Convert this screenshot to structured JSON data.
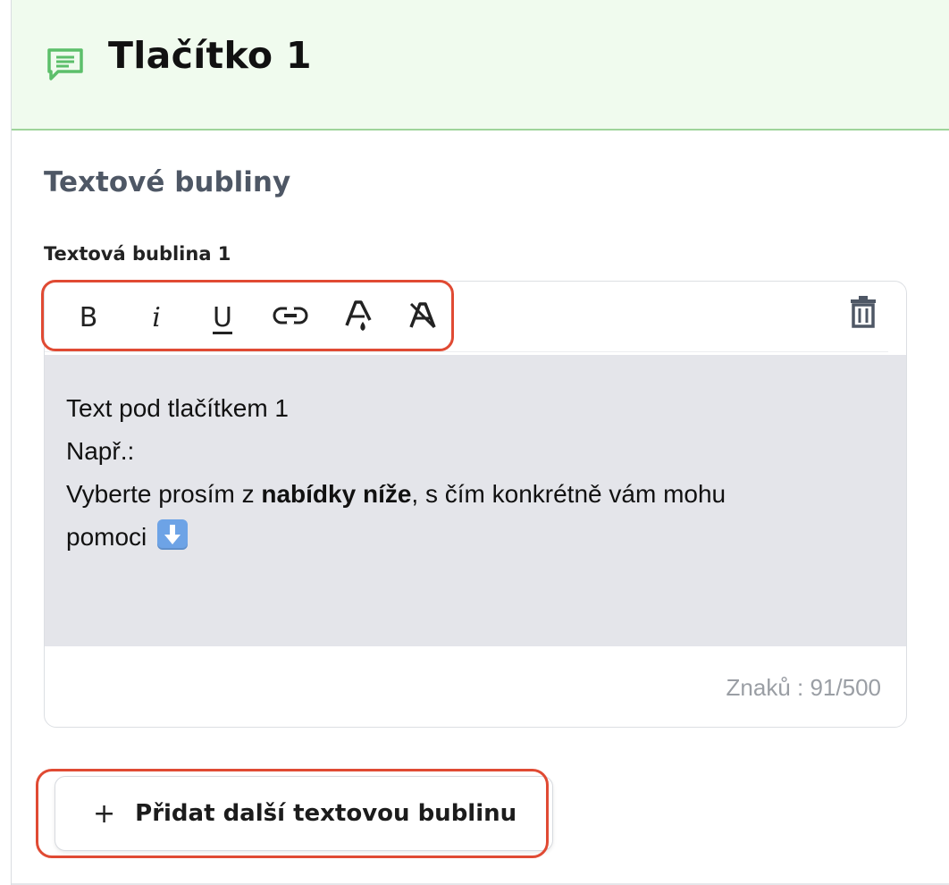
{
  "header": {
    "title": "Tlačítko 1",
    "icon": "chat-bubble-icon",
    "background": "#f0fbee",
    "accent": "#9fd49a"
  },
  "section": {
    "title": "Textové bubliny",
    "bubble_label": "Textová bublina 1"
  },
  "toolbar": {
    "buttons": [
      {
        "name": "bold",
        "glyph": "B"
      },
      {
        "name": "italic",
        "glyph": "i"
      },
      {
        "name": "underline",
        "glyph": "U"
      },
      {
        "name": "link",
        "glyph": "link-icon"
      },
      {
        "name": "text-color",
        "glyph": "text-color-icon"
      },
      {
        "name": "clear-format",
        "glyph": "clear-format-icon"
      }
    ],
    "delete_icon": "trash-icon"
  },
  "editor": {
    "line1": "Text pod tlačítkem 1",
    "line2": "Např.:",
    "line3_before": "Vyberte prosím z ",
    "line3_bold": "nabídky níže",
    "line3_after": ", s čím konkrétně vám mohu",
    "line4": "pomoci",
    "emoji": "down-arrow-emoji",
    "char_count": "Znaků : 91/500"
  },
  "add_button": {
    "plus": "+",
    "label": "Přidat další textovou bublinu"
  },
  "colors": {
    "highlight": "#e04a33",
    "editor_background": "#e4e5ea"
  }
}
